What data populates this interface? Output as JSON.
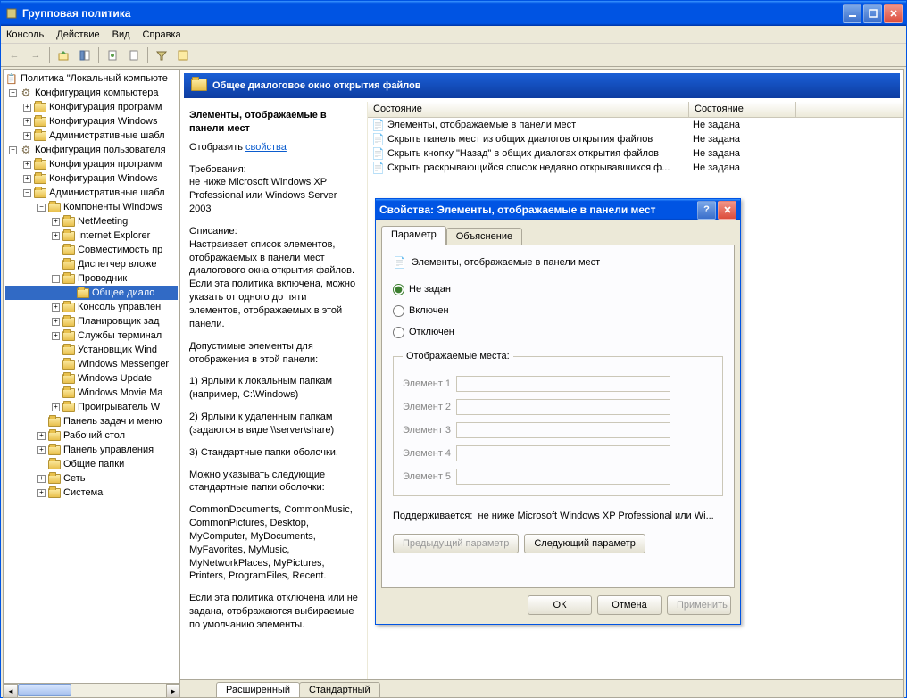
{
  "window": {
    "title": "Групповая политика"
  },
  "menu": {
    "console": "Консоль",
    "action": "Действие",
    "view": "Вид",
    "help": "Справка"
  },
  "tree": {
    "root": "Политика \"Локальный компьюте",
    "comp_config": "Конфигурация компьютера",
    "comp_soft": "Конфигурация программ",
    "comp_win": "Конфигурация Windows",
    "comp_admin": "Административные шабл",
    "user_config": "Конфигурация пользователя",
    "user_soft": "Конфигурация программ",
    "user_win": "Конфигурация Windows",
    "user_admin": "Административные шабл",
    "win_comp": "Компоненты Windows",
    "netmeeting": "NetMeeting",
    "ie": "Internet Explorer",
    "compat": "Совместимость пр",
    "attach": "Диспетчер вложе",
    "explorer": "Проводник",
    "common_dialog": "Общее диало",
    "mmc": "Консоль управлен",
    "task_sched": "Планировщик зад",
    "term_serv": "Службы терминал",
    "installer": "Установщик Wind",
    "messenger": "Windows Messenger",
    "update": "Windows Update",
    "moviemaker": "Windows Movie Ma",
    "player": "Проигрыватель W",
    "taskbar": "Панель задач и меню",
    "desktop": "Рабочий стол",
    "cpanel": "Панель управления",
    "shared": "Общие папки",
    "network": "Сеть",
    "system": "Система"
  },
  "content": {
    "header": "Общее диалоговое окно открытия файлов",
    "desc_title": "Элементы, отображаемые в панели мест",
    "show_label": "Отобразить",
    "show_link": "свойства",
    "req_label": "Требования:",
    "req_text": "не ниже Microsoft Windows XP Professional или Windows Server 2003",
    "desc_label": "Описание:",
    "desc_text": "Настраивает список элементов, отображаемых в панели мест диалогового окна открытия файлов. Если эта политика включена, можно указать от одного до пяти элементов, отображаемых в этой панели.",
    "allowed_label": "Допустимые элементы для отображения в этой панели:",
    "item1": "1) Ярлыки к локальным папкам (например, C:\\Windows)",
    "item2": "2) Ярлыки к удаленным папкам (задаются в виде \\\\server\\share)",
    "item3": "3) Стандартные папки оболочки.",
    "folders_label": "Можно указывать следующие стандартные папки оболочки:",
    "folders_list": "CommonDocuments, CommonMusic, CommonPictures, Desktop, MyComputer, MyDocuments, MyFavorites, MyMusic, MyNetworkPlaces, MyPictures, Printers, ProgramFiles, Recent.",
    "footer": "Если эта политика отключена или не задана, отображаются выбираемые по умолчанию элементы."
  },
  "list": {
    "col_name": "Состояние",
    "col_state": "Состояние",
    "rows": [
      {
        "name": "Элементы, отображаемые в панели мест",
        "state": "Не задана"
      },
      {
        "name": "Скрыть панель мест из общих диалогов открытия файлов",
        "state": "Не задана"
      },
      {
        "name": "Скрыть кнопку \"Назад\" в общих диалогах открытия файлов",
        "state": "Не задана"
      },
      {
        "name": "Скрыть раскрывающийся список недавно открывавшихся ф...",
        "state": "Не задана"
      }
    ]
  },
  "tabs": {
    "extended": "Расширенный",
    "standard": "Стандартный"
  },
  "dialog": {
    "title": "Свойства: Элементы, отображаемые в панели мест",
    "tab_param": "Параметр",
    "tab_explain": "Объяснение",
    "heading": "Элементы, отображаемые в панели мест",
    "r_notconfig": "Не задан",
    "r_enabled": "Включен",
    "r_disabled": "Отключен",
    "group": "Отображаемые места:",
    "e1": "Элемент 1",
    "e2": "Элемент 2",
    "e3": "Элемент 3",
    "e4": "Элемент 4",
    "e5": "Элемент 5",
    "supported_label": "Поддерживается:",
    "supported_text": "не ниже Microsoft Windows XP Professional или Wi...",
    "prev": "Предыдущий параметр",
    "next": "Следующий параметр",
    "ok": "ОК",
    "cancel": "Отмена",
    "apply": "Применить"
  }
}
